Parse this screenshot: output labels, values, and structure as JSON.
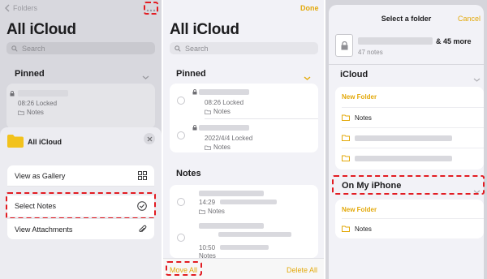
{
  "panel1": {
    "back_label": "Folders",
    "title": "All iCloud",
    "search_placeholder": "Search",
    "pinned_label": "Pinned",
    "pinned_note": {
      "meta": "08:26  Locked",
      "folder": "Notes"
    },
    "sheet": {
      "folder_name": "All iCloud",
      "menu": [
        {
          "label": "View as Gallery",
          "icon": "grid-icon"
        },
        {
          "label": "Select Notes",
          "icon": "checkmark-circle-icon"
        },
        {
          "label": "View Attachments",
          "icon": "paperclip-icon"
        }
      ]
    }
  },
  "panel2": {
    "done_label": "Done",
    "title": "All iCloud",
    "search_placeholder": "Search",
    "pinned_label": "Pinned",
    "pinned_notes": [
      {
        "meta": "08:26  Locked",
        "folder": "Notes"
      },
      {
        "meta": "2022/4/4  Locked",
        "folder": "Notes"
      }
    ],
    "notes_label": "Notes",
    "notes": [
      {
        "meta": "14:29",
        "folder": "Notes"
      },
      {
        "meta": "",
        "folder": "Notes"
      },
      {
        "meta": "10:50",
        "folder": "Notes"
      }
    ],
    "move_all_label": "Move All",
    "delete_all_label": "Delete All"
  },
  "panel3": {
    "title": "Select a folder",
    "cancel_label": "Cancel",
    "selection_more": "& 45 more",
    "selection_count": "47 notes",
    "icloud_label": "iCloud",
    "new_folder_label": "New Folder",
    "icloud_folders": [
      "Notes"
    ],
    "on_my_iphone_label": "On My iPhone",
    "phone_new_folder_label": "New Folder",
    "phone_folders": [
      "Notes"
    ]
  },
  "colors": {
    "accent": "#e3a90b",
    "highlight": "#e21c22"
  }
}
